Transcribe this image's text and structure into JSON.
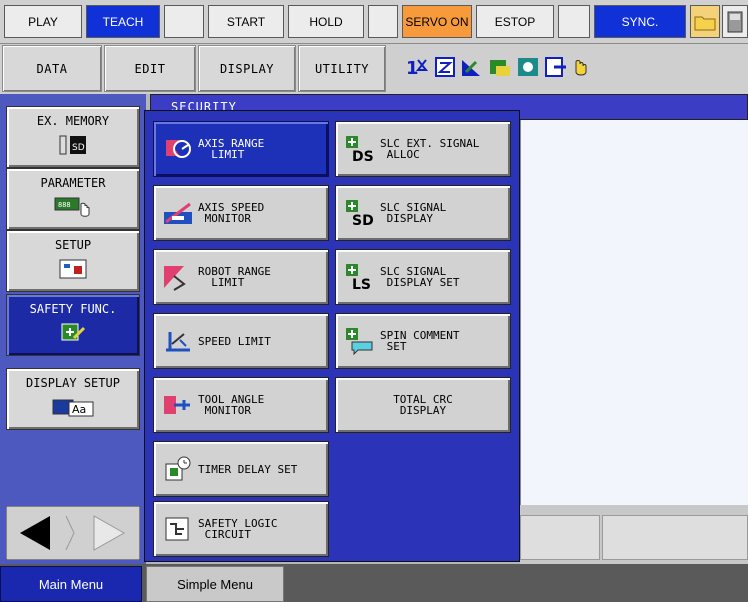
{
  "status_bar": {
    "play": "PLAY",
    "teach": "TEACH",
    "start": "START",
    "hold": "HOLD",
    "servo_on": "SERVO ON",
    "estop": "ESTOP",
    "sync": "SYNC."
  },
  "menu_bar": {
    "data": "DATA",
    "edit": "EDIT",
    "display": "DISPLAY",
    "utility": "UTILITY",
    "status_icons": [
      "axis-number-icon",
      "cartesian-frame-icon",
      "tool-frame-icon",
      "security-icon",
      "camera-icon",
      "mode-icon",
      "hand-cursor-icon"
    ]
  },
  "left_menu": {
    "items": [
      {
        "label": "EX. MEMORY",
        "icon": "sd-card-icon"
      },
      {
        "label": "PARAMETER",
        "icon": "parameter-hand-icon"
      },
      {
        "label": "SETUP",
        "icon": "setup-icon"
      },
      {
        "label": "SAFETY FUNC.",
        "icon": "safety-func-icon",
        "active": true
      },
      {
        "label": "DISPLAY SETUP",
        "icon": "display-setup-icon"
      }
    ]
  },
  "window_title": "SECURITY",
  "submenu": {
    "left_column": [
      {
        "label": "AXIS RANGE\n  LIMIT",
        "icon": "axis-range-icon",
        "selected": true
      },
      {
        "label": "AXIS SPEED\n MONITOR",
        "icon": "axis-speed-icon"
      },
      {
        "label": "ROBOT RANGE\n  LIMIT",
        "icon": "robot-range-icon"
      },
      {
        "label": "SPEED LIMIT",
        "icon": "speed-limit-icon"
      },
      {
        "label": "TOOL ANGLE\n MONITOR",
        "icon": "tool-angle-icon"
      },
      {
        "label": "TIMER DELAY SET",
        "icon": "timer-delay-icon"
      },
      {
        "label": "SAFETY LOGIC\n CIRCUIT",
        "icon": "safety-logic-icon"
      }
    ],
    "right_column": [
      {
        "label": "SLC EXT. SIGNAL\n ALLOC",
        "icon": "slc-ds-icon"
      },
      {
        "label": "SLC SIGNAL\n DISPLAY",
        "icon": "slc-sd-icon"
      },
      {
        "label": "SLC SIGNAL\n DISPLAY SET",
        "icon": "slc-ls-icon"
      },
      {
        "label": "SPIN COMMENT\n SET",
        "icon": "spin-comment-icon"
      },
      {
        "label": "TOTAL CRC\nDISPLAY",
        "icon": null
      }
    ]
  },
  "bottom_tabs": {
    "main_menu": "Main Menu",
    "simple_menu": "Simple Menu"
  }
}
